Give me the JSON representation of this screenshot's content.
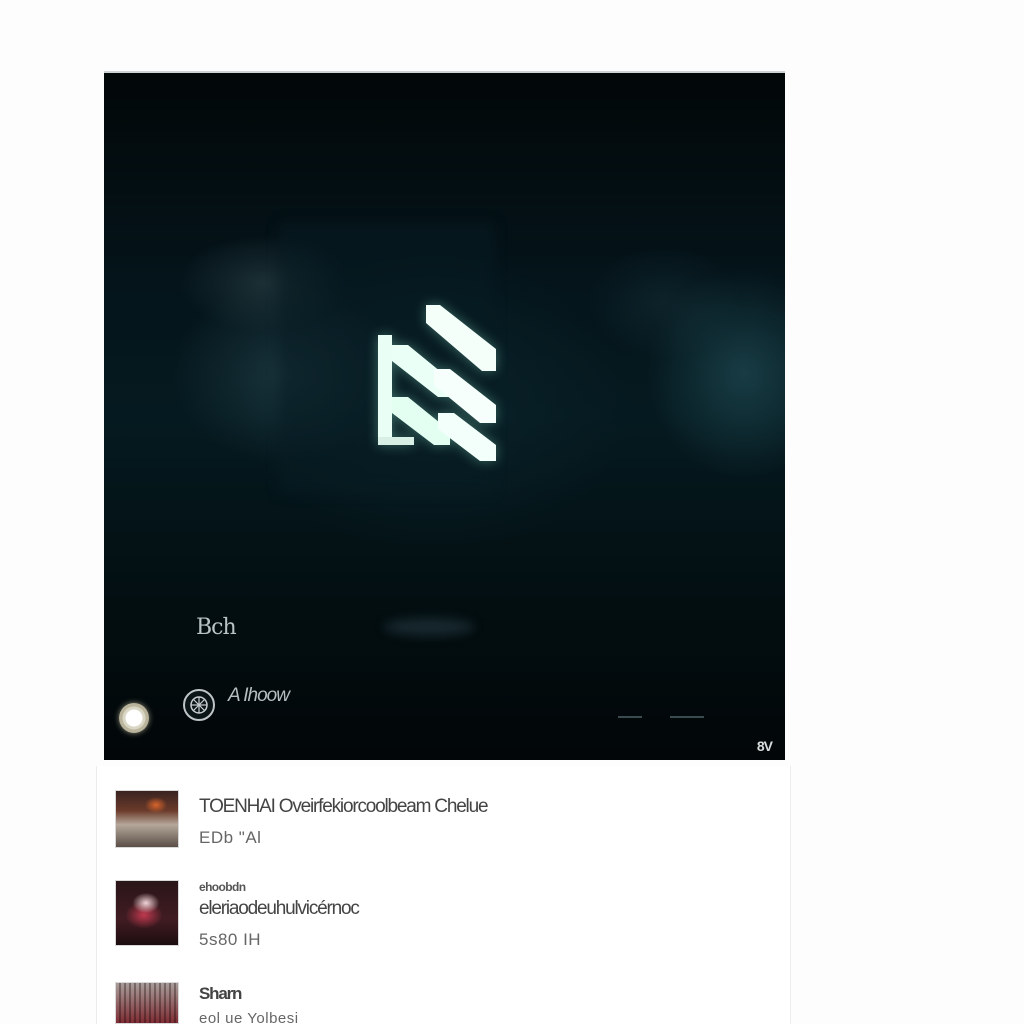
{
  "player": {
    "logo_icon": "stylized-lightning-logo-icon",
    "channel_name": "Bch",
    "caption": "A Ihoow",
    "corner_badge": "8V",
    "controls": {
      "play_icon": "play-circle-icon",
      "settings_icon": "settings-wheel-icon"
    },
    "colors": {
      "background": "#02090b",
      "logo_glow": "#9ff5d9",
      "text": "#b9c2c4"
    }
  },
  "playlist": {
    "items": [
      {
        "title": "TOENHAI Oveirfekiorcoolbeam Chelue",
        "meta": "EDb  \"Al",
        "kicker": ""
      },
      {
        "kicker": "ehoobdn",
        "title": "eleriaodeuhulvicérnoc",
        "meta": "5s80  IH"
      },
      {
        "kicker": "",
        "title": "Sharn",
        "meta": "eol ue Yolbesi"
      }
    ]
  }
}
